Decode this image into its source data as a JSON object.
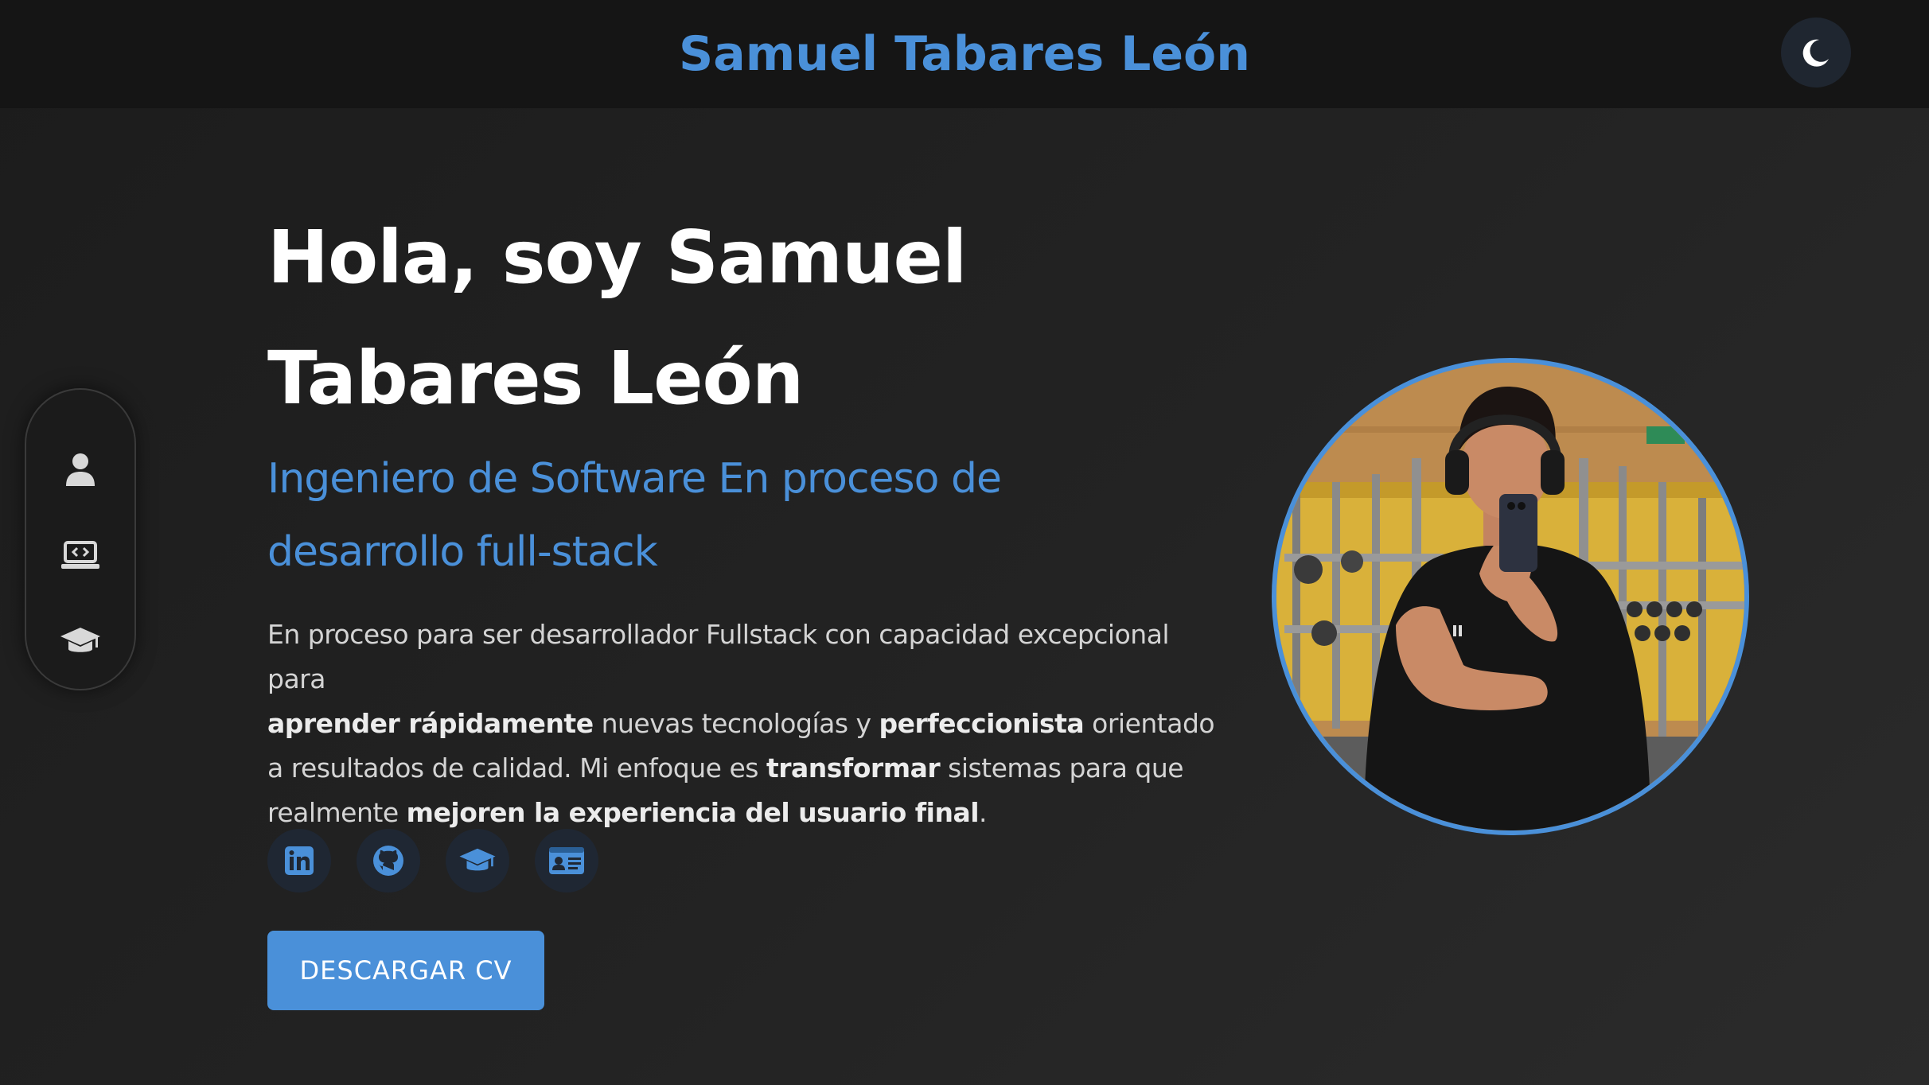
{
  "header": {
    "site_title": "Samuel Tabares León",
    "theme_toggle_icon": "moon-icon"
  },
  "side_nav": {
    "items": [
      {
        "name": "profile",
        "icon": "user-icon"
      },
      {
        "name": "projects",
        "icon": "laptop-code-icon"
      },
      {
        "name": "education",
        "icon": "graduation-cap-icon"
      }
    ]
  },
  "hero": {
    "title_line1": "Hola, soy Samuel",
    "title_line2": "Tabares León",
    "subtitle_line1": "Ingeniero de Software En proceso de",
    "subtitle_line2": "desarrollo full-stack",
    "desc": {
      "t1": "En proceso para ser desarrollador Fullstack con capacidad excepcional para",
      "b1": "aprender rápidamente",
      "t2": " nuevas tecnologías y ",
      "b2": "perfeccionista",
      "t3": " orientado a resultados de calidad. Mi enfoque es ",
      "b3": "transformar",
      "t4": " sistemas para que realmente ",
      "b4": "mejoren la experiencia del usuario final",
      "t5": "."
    },
    "socials": [
      {
        "name": "linkedin",
        "icon": "linkedin-icon"
      },
      {
        "name": "github",
        "icon": "github-icon"
      },
      {
        "name": "education",
        "icon": "graduation-cap-icon"
      },
      {
        "name": "id-card",
        "icon": "id-card-icon"
      }
    ],
    "cv_button_label": "DESCARGAR CV"
  },
  "colors": {
    "accent": "#4a90d9",
    "background": "#1c1c1c",
    "header_bg": "#151515",
    "text": "#ffffff",
    "muted_text": "#d4d4d4"
  }
}
